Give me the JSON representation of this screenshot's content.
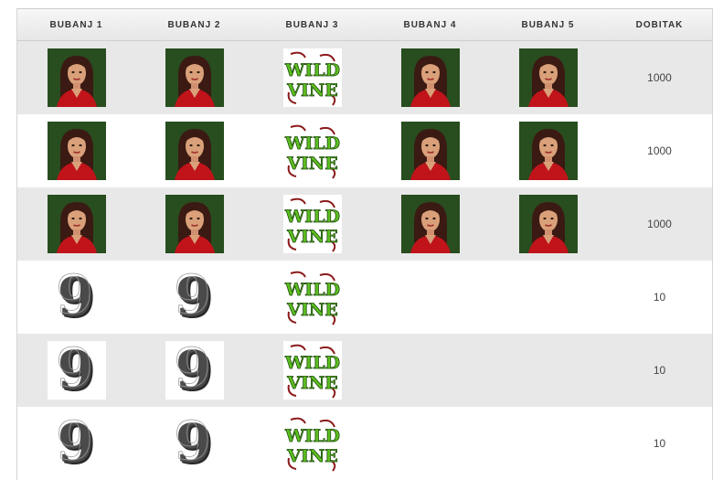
{
  "columns": [
    "BUBANJ 1",
    "BUBANJ 2",
    "BUBANJ 3",
    "BUBANJ 4",
    "BUBANJ 5",
    "DOBITAK"
  ],
  "symbols": {
    "woman": {
      "icon": "woman-in-red-icon",
      "alt": "woman"
    },
    "wild": {
      "icon": "wild-vine-icon",
      "text_top": "WILD",
      "text_bottom": "VINE"
    },
    "nine": {
      "icon": "nine-symbol-icon",
      "glyph": "9"
    }
  },
  "rows": [
    {
      "reels": [
        "woman",
        "woman",
        "wild",
        "woman",
        "woman"
      ],
      "win": "1000",
      "shaded": true
    },
    {
      "reels": [
        "woman",
        "woman",
        "wild",
        "woman",
        "woman"
      ],
      "win": "1000",
      "shaded": false
    },
    {
      "reels": [
        "woman",
        "woman",
        "wild",
        "woman",
        "woman"
      ],
      "win": "1000",
      "shaded": true
    },
    {
      "reels": [
        "nine",
        "nine",
        "wild",
        "",
        ""
      ],
      "win": "10",
      "shaded": false
    },
    {
      "reels": [
        "nine",
        "nine",
        "wild",
        "",
        ""
      ],
      "win": "10",
      "shaded": true
    },
    {
      "reels": [
        "nine",
        "nine",
        "wild",
        "",
        ""
      ],
      "win": "10",
      "shaded": false
    }
  ],
  "colors": {
    "header_bg": "#ececec",
    "row_shaded": "#e8e8e8",
    "wild_green": "#5cbf1f",
    "wild_red": "#8b1a1a",
    "dress_red": "#c0141a",
    "nine_gray": "#4a4a4a"
  }
}
